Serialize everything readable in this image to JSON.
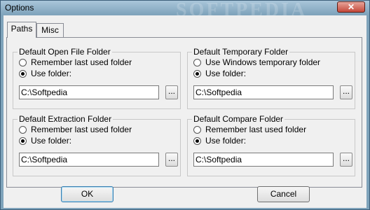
{
  "window": {
    "title": "Options",
    "close_glyph": "✕",
    "watermark": "SOFTPEDIA"
  },
  "tabs": [
    {
      "label": "Paths",
      "active": true
    },
    {
      "label": "Misc",
      "active": false
    }
  ],
  "groups": {
    "open": {
      "title": "Default Open File Folder",
      "option1": "Remember last used folder",
      "option2": "Use folder:",
      "selected": 2,
      "path": "C:\\Softpedia",
      "browse": "..."
    },
    "temp": {
      "title": "Default Temporary Folder",
      "option1": "Use Windows temporary folder",
      "option2": "Use folder:",
      "selected": 2,
      "path": "C:\\Softpedia",
      "browse": "..."
    },
    "extract": {
      "title": "Default Extraction Folder",
      "option1": "Remember last used folder",
      "option2": "Use folder:",
      "selected": 2,
      "path": "C:\\Softpedia",
      "browse": "..."
    },
    "compare": {
      "title": "Default Compare Folder",
      "option1": "Remember last used folder",
      "option2": "Use folder:",
      "selected": 2,
      "path": "C:\\Softpedia",
      "browse": "..."
    }
  },
  "buttons": {
    "ok": "OK",
    "cancel": "Cancel"
  },
  "colors": {
    "title_bar": "#7fa3bb",
    "close_button": "#c4483a",
    "dialog_face": "#f0f0f0"
  }
}
